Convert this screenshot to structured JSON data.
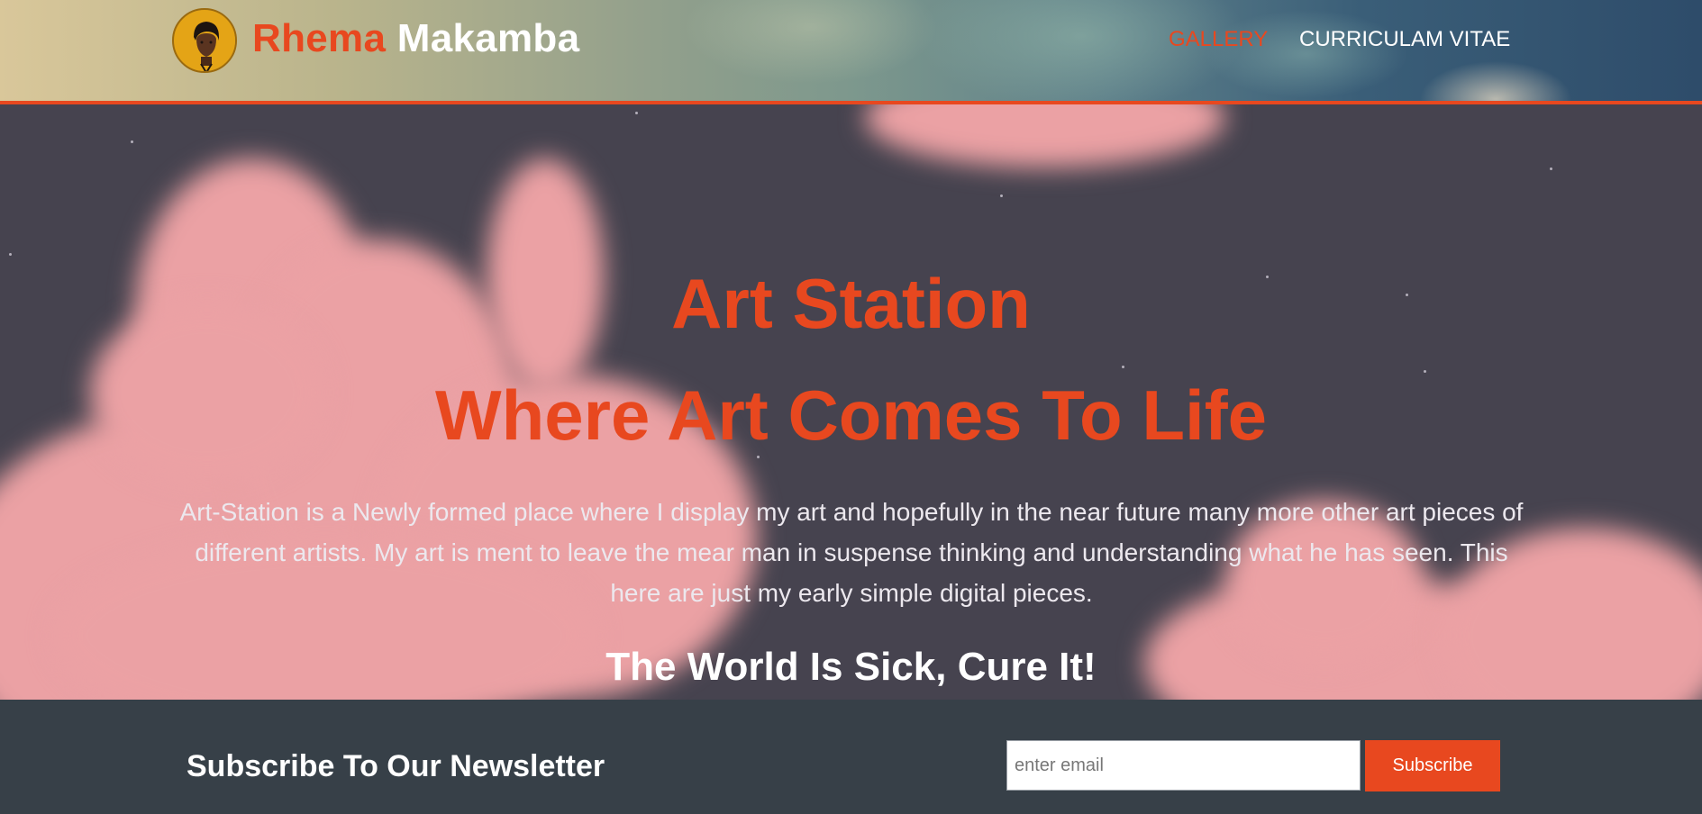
{
  "header": {
    "brand_first": "Rhema",
    "brand_last": "Makamba",
    "logo_icon": "avatar-portrait-icon",
    "nav": [
      {
        "label": "GALLERY",
        "active": true
      },
      {
        "label": "CURRICULAM VITAE",
        "active": false
      }
    ]
  },
  "hero": {
    "title_line1": "Art Station",
    "title_line2": "Where Art Comes To Life",
    "description": "Art-Station is a Newly formed place where I display my art and hopefully in the near future many more other art pieces of different artists. My art is ment to leave the mear man in suspense thinking and understanding what he has seen. This here are just my early simple digital pieces.",
    "slogan": "The World Is Sick, Cure It!"
  },
  "newsletter": {
    "title": "Subscribe To Our Newsletter",
    "email_placeholder": "enter email",
    "email_value": "",
    "button_label": "Subscribe"
  },
  "colors": {
    "accent": "#e8481f",
    "footer_bg": "#374048",
    "hero_bg": "#46434f",
    "cloud": "#eba1a4"
  }
}
